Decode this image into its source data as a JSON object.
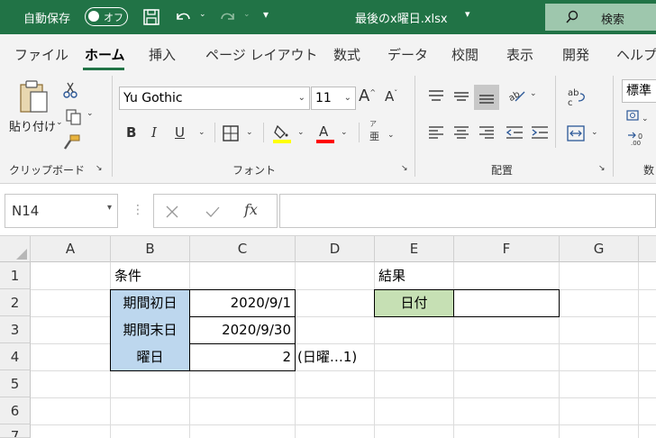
{
  "titlebar": {
    "autosave_label": "自動保存",
    "autosave_state": "オフ",
    "filename": "最後のx曜日.xlsx",
    "search": "検索"
  },
  "tabs": [
    "ファイル",
    "ホーム",
    "挿入",
    "ページ レイアウト",
    "数式",
    "データ",
    "校閲",
    "表示",
    "開発",
    "ヘルプ"
  ],
  "active_tab": "ホーム",
  "ribbon": {
    "paste_label": "貼り付け",
    "clipboard_label": "クリップボード",
    "font_name": "Yu Gothic",
    "font_size": "11",
    "bold": "B",
    "italic": "I",
    "underline": "U",
    "font_group_label": "フォント",
    "phonetic": "亜",
    "alignment_label": "配置",
    "number_format": "標準",
    "number_group_label_partial": "数"
  },
  "formula_bar": {
    "name_box": "N14",
    "fx": "fx"
  },
  "colors": {
    "excel_green": "#217346",
    "highlight_yellow": "#ffff00",
    "font_red": "#ff0000",
    "cell_blue": "#bdd7ee",
    "cell_green": "#c6e0b4"
  },
  "sheet": {
    "columns": [
      "A",
      "B",
      "C",
      "D",
      "E",
      "F",
      "G"
    ],
    "rows": [
      "1",
      "2",
      "3",
      "4",
      "5",
      "6",
      "7"
    ],
    "cells": {
      "B1": "条件",
      "E1": "結果",
      "B2": "期間初日",
      "C2": "2020/9/1",
      "E2": "日付",
      "F2": "",
      "B3": "期間末日",
      "C3": "2020/9/30",
      "B4": "曜日",
      "C4": "2",
      "D4": "(日曜…1)"
    }
  }
}
